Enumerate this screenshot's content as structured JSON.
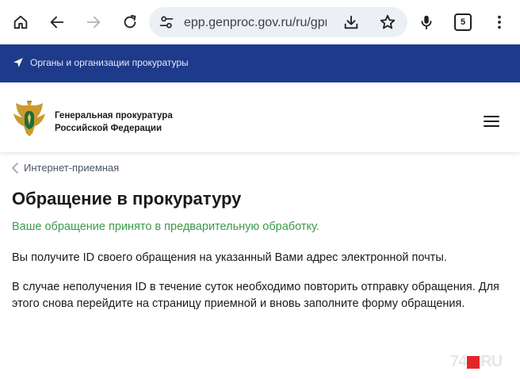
{
  "browser": {
    "url": "epp.genproc.gov.ru/ru/gpr",
    "tab_count": "5",
    "icons": {
      "home": "home-icon",
      "back": "arrow-left-icon",
      "forward": "arrow-right-icon",
      "reload": "reload-icon",
      "site_settings": "tune-icon",
      "download": "download-icon",
      "bookmark": "star-icon",
      "voice": "microphone-icon",
      "menu": "more-vert-icon"
    }
  },
  "topbar": {
    "link_label": "Органы и организации прокуратуры",
    "background": "#1e3a8a"
  },
  "header": {
    "org_line1": "Генеральная прокуратура",
    "org_line2": "Российской Федерации"
  },
  "breadcrumb": {
    "label": "Интернет-приемная"
  },
  "main": {
    "title": "Обращение в прокуратуру",
    "status_message": "Ваше обращение принято в предварительную обработку.",
    "status_color": "#3c9a4c",
    "paragraph1": "Вы получите ID своего обращения на указанный Вами адрес электронной почты.",
    "paragraph2": "В случае неполучения ID в течение суток необходимо повторить отправку обращения. Для этого снова перейдите на страницу приемной и вновь заполните форму обращения."
  },
  "watermark": {
    "left": "74",
    "right": "RU"
  }
}
